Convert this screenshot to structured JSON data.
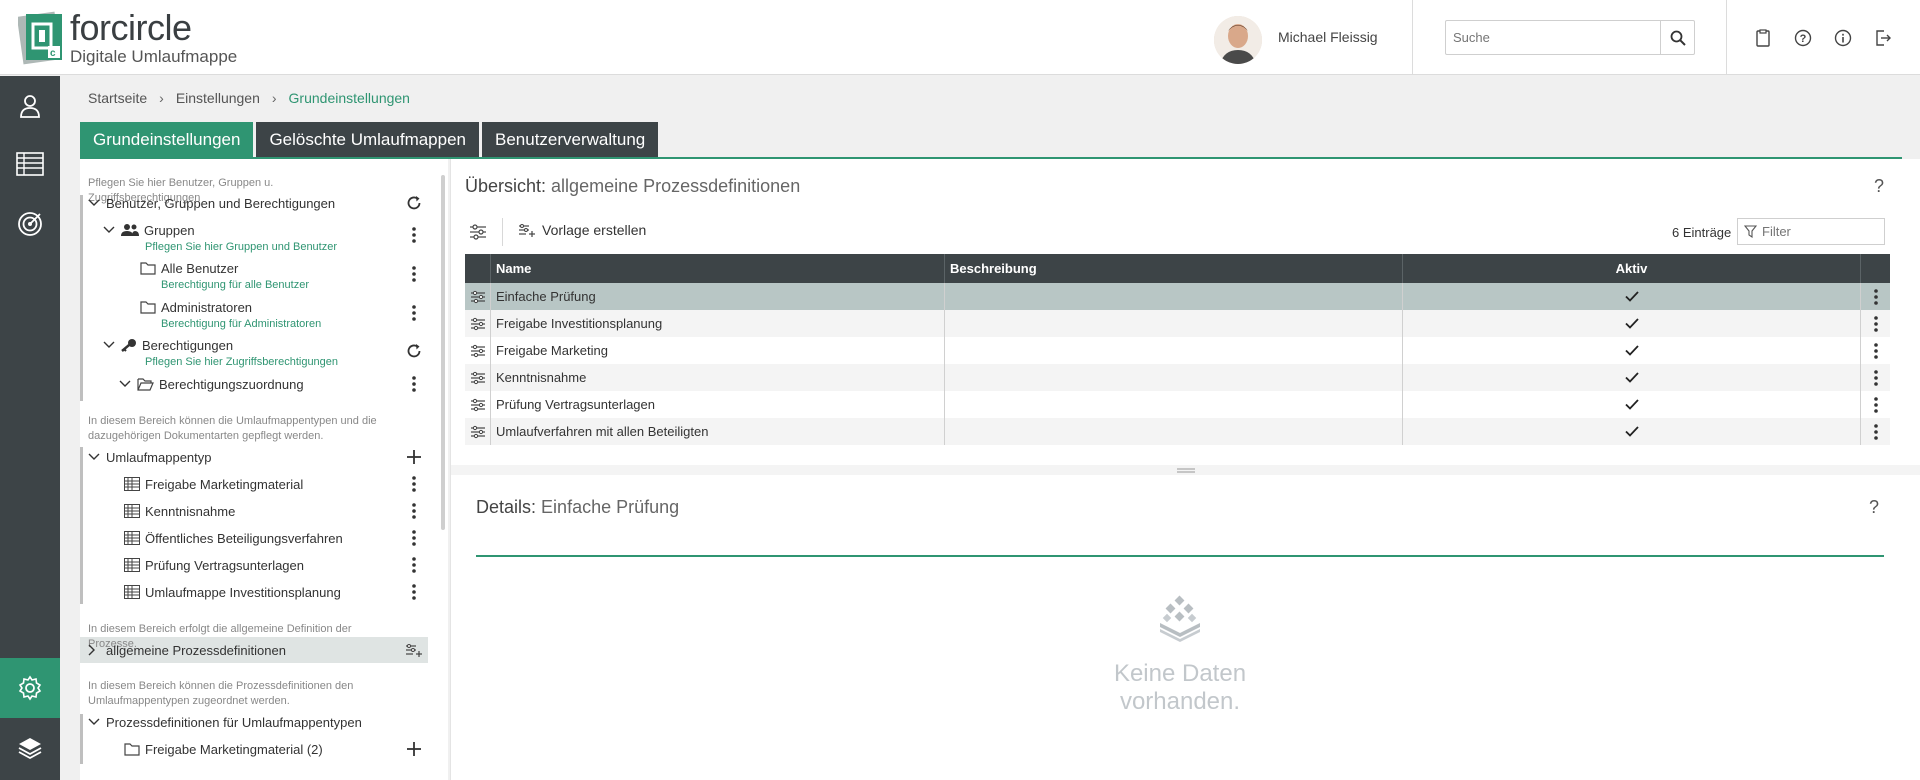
{
  "header": {
    "brand": "forcircle",
    "tagline": "Digitale Umlaufmappe",
    "user_name": "Michael Fleissig",
    "search_placeholder": "Suche"
  },
  "breadcrumb": [
    "Startseite",
    "Einstellungen",
    "Grundeinstellungen"
  ],
  "tabs": [
    "Grundeinstellungen",
    "Gelöschte Umlaufmappen",
    "Benutzerverwaltung"
  ],
  "tree": {
    "note_users": "Pflegen Sie hier Benutzer, Gruppen u. Zugriffsberechtigungen",
    "users_root": "Benutzer, Gruppen und Berechtigungen",
    "groups": "Gruppen",
    "groups_sub": "Pflegen Sie hier Gruppen und Benutzer",
    "all_users": "Alle Benutzer",
    "all_users_sub": "Berechtigung für alle Benutzer",
    "admins": "Administratoren",
    "admins_sub": "Berechtigung für Administratoren",
    "permissions": "Berechtigungen",
    "permissions_sub": "Pflegen Sie hier Zugriffsberechtigungen",
    "permission_mapping": "Berechtigungszuordnung",
    "note_types": "In diesem Bereich können die Umlaufmappentypen und die dazugehörigen Dokumentarten gepflegt werden.",
    "types_root": "Umlaufmappentyp",
    "types": [
      "Freigabe Marketingmaterial",
      "Kenntnisnahme",
      "Öffentliches Beteiligungsverfahren",
      "Prüfung Vertragsunterlagen",
      "Umlaufmappe Investitionsplanung"
    ],
    "note_process": "In diesem Bereich erfolgt die allgemeine Definition der Prozesse.",
    "process_root": "allgemeine Prozessdefinitionen",
    "note_mapping": "In diesem Bereich können die Prozessdefinitionen den Umlaufmappentypen zugeordnet werden.",
    "mapping_root": "Prozessdefinitionen für Umlaufmappentypen",
    "mapping_child": "Freigabe Marketingmaterial (2)"
  },
  "overview": {
    "title_prefix": "Übersicht:",
    "title_suffix": "allgemeine Prozessdefinitionen",
    "create_template": "Vorlage erstellen",
    "entries": "6 Einträge",
    "filter_placeholder": "Filter",
    "help": "?"
  },
  "grid": {
    "columns": [
      "Name",
      "Beschreibung",
      "Aktiv"
    ],
    "rows": [
      {
        "name": "Einfache Prüfung",
        "desc": "",
        "active": true
      },
      {
        "name": "Freigabe Investitionsplanung",
        "desc": "",
        "active": true
      },
      {
        "name": "Freigabe Marketing",
        "desc": "",
        "active": true
      },
      {
        "name": "Kenntnisnahme",
        "desc": "",
        "active": true
      },
      {
        "name": "Prüfung Vertragsunterlagen",
        "desc": "",
        "active": true
      },
      {
        "name": "Umlaufverfahren mit allen Beteiligten",
        "desc": "",
        "active": true
      }
    ]
  },
  "details": {
    "title_prefix": "Details:",
    "title_suffix": "Einfache Prüfung",
    "empty": "Keine Daten vorhanden.",
    "help": "?"
  },
  "colors": {
    "accent": "#2f9572",
    "dark": "#3d4447"
  }
}
